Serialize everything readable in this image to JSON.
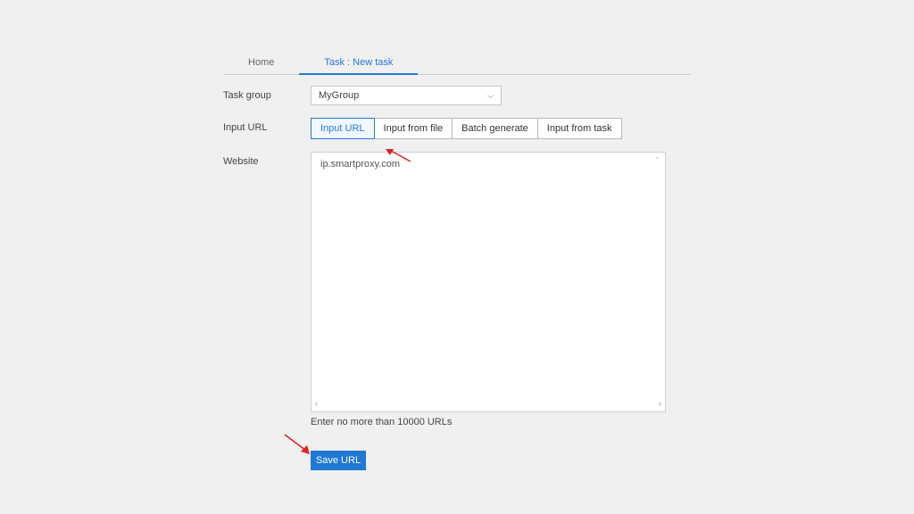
{
  "tabs": {
    "home": "Home",
    "task": "Task : New task"
  },
  "form": {
    "task_group_label": "Task group",
    "task_group_value": "MyGroup",
    "input_url_label": "Input URL",
    "website_label": "Website",
    "url_modes": {
      "input_url": "Input URL",
      "input_from_file": "Input from file",
      "batch_generate": "Batch generate",
      "input_from_task": "Input from task"
    },
    "website_value": "ip.smartproxy.com",
    "hint": "Enter no more than 10000 URLs"
  },
  "buttons": {
    "save_url": "Save URL"
  }
}
